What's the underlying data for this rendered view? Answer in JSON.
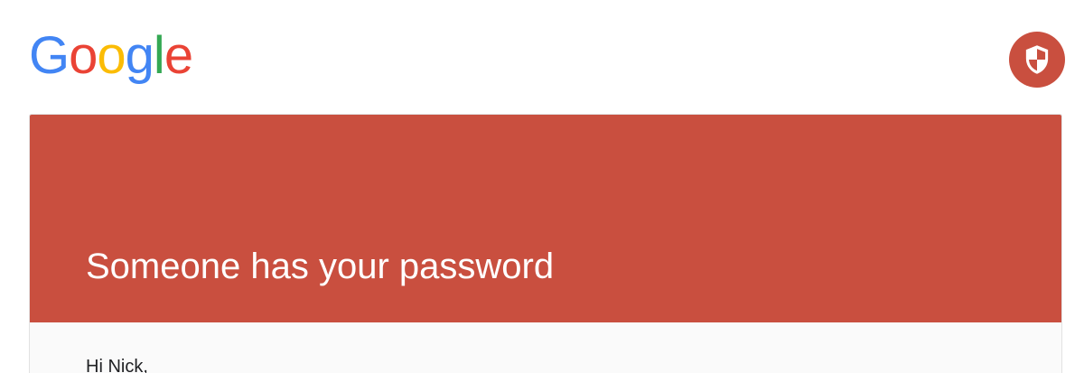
{
  "header": {
    "logo": {
      "letters": [
        {
          "char": "G",
          "color": "#4285F4"
        },
        {
          "char": "o",
          "color": "#EA4335"
        },
        {
          "char": "o",
          "color": "#FBBC05"
        },
        {
          "char": "g",
          "color": "#4285F4"
        },
        {
          "char": "l",
          "color": "#34A853"
        },
        {
          "char": "e",
          "color": "#EA4335"
        }
      ]
    },
    "security_badge": {
      "icon": "shield-icon",
      "background_color": "#C94F3F",
      "icon_color": "#ffffff"
    }
  },
  "alert": {
    "banner_color": "#C94F3F",
    "title": "Someone has your password",
    "greeting": "Hi Nick,"
  }
}
